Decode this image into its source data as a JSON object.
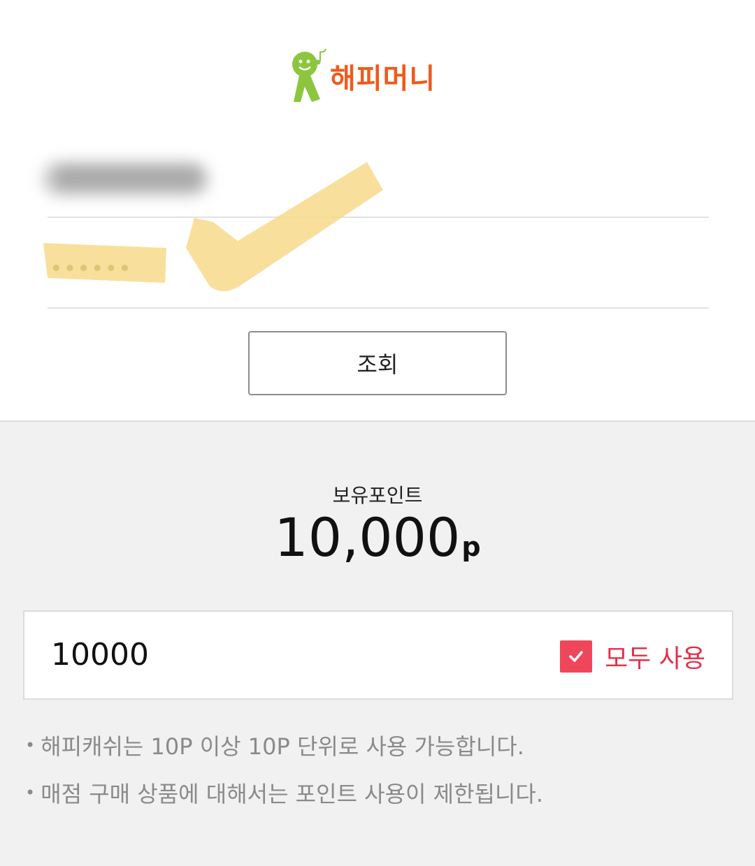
{
  "logo": {
    "text": "해피머니",
    "icon": "happymoney-mascot-icon"
  },
  "login": {
    "id_value": "(blurred)",
    "password_mask": "••••••",
    "query_button_label": "조회"
  },
  "points": {
    "label": "보유포인트",
    "value": "10,000",
    "unit": "p"
  },
  "use_input": {
    "value": "10000",
    "use_all_checked": true,
    "use_all_label": "모두 사용"
  },
  "notes": [
    "해피캐쉬는 10P 이상 10P 단위로 사용 가능합니다.",
    "매점 구매 상품에 대해서는 포인트 사용이 제한됩니다."
  ],
  "colors": {
    "brand_orange": "#ef5a1c",
    "mascot_green": "#8cc63f",
    "accent_red": "#f0465c",
    "overlay_highlight": "#f7d98a"
  }
}
